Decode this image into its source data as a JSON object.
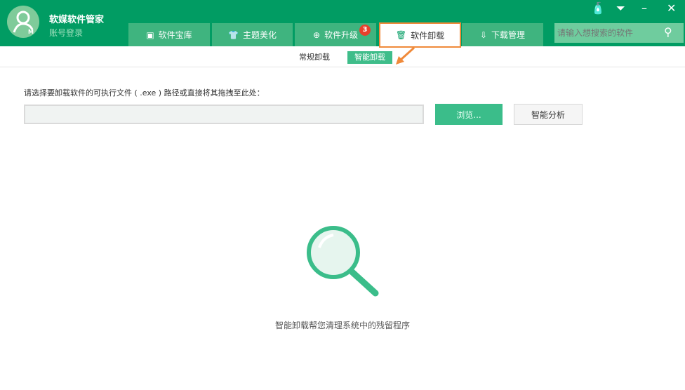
{
  "app": {
    "title": "软媒软件管家",
    "login": "账号登录"
  },
  "tabs": [
    {
      "label": "软件宝库",
      "icon": "box-icon"
    },
    {
      "label": "主题美化",
      "icon": "tshirt-icon"
    },
    {
      "label": "软件升级",
      "icon": "upgrade-icon",
      "badge": "3"
    },
    {
      "label": "软件卸载",
      "icon": "trash-icon",
      "active": true
    },
    {
      "label": "下载管理",
      "icon": "download-icon"
    }
  ],
  "search": {
    "placeholder": "请输入想搜索的软件"
  },
  "subtabs": [
    {
      "label": "常规卸载"
    },
    {
      "label": "智能卸载",
      "active": true
    }
  ],
  "main": {
    "prompt": "请选择要卸载软件的可执行文件 ( .exe ) 路径或直接将其拖拽至此处：",
    "path_value": "",
    "browse": "浏览...",
    "analyze": "智能分析",
    "caption": "智能卸载帮您清理系统中的残留程序"
  },
  "colors": {
    "brand": "#019c63",
    "accent": "#3bbd8a",
    "highlight": "#f08a3a",
    "badge": "#e8402c"
  }
}
